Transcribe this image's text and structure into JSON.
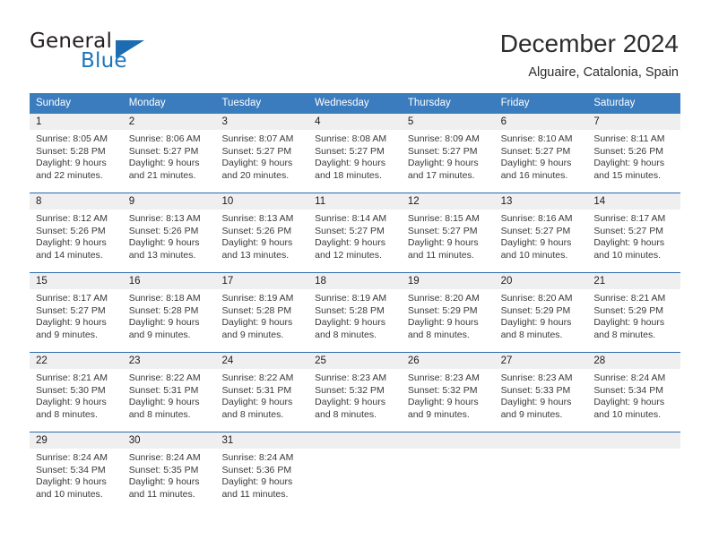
{
  "brand": {
    "name_part1": "General",
    "name_part2": "Blue",
    "flag_icon": "triangle-flag-icon",
    "accent_color": "#1b75bb"
  },
  "header": {
    "title": "December 2024",
    "location": "Alguaire, Catalonia, Spain"
  },
  "theme": {
    "header_row_bg": "#3b7cbe",
    "week_divider": "#2b6cad",
    "daynum_band_bg": "#efefef",
    "text_color": "#39393b"
  },
  "weekdays": [
    "Sunday",
    "Monday",
    "Tuesday",
    "Wednesday",
    "Thursday",
    "Friday",
    "Saturday"
  ],
  "weeks": [
    {
      "days": [
        {
          "num": "1",
          "sunrise": "Sunrise: 8:05 AM",
          "sunset": "Sunset: 5:28 PM",
          "daylight1": "Daylight: 9 hours",
          "daylight2": "and 22 minutes."
        },
        {
          "num": "2",
          "sunrise": "Sunrise: 8:06 AM",
          "sunset": "Sunset: 5:27 PM",
          "daylight1": "Daylight: 9 hours",
          "daylight2": "and 21 minutes."
        },
        {
          "num": "3",
          "sunrise": "Sunrise: 8:07 AM",
          "sunset": "Sunset: 5:27 PM",
          "daylight1": "Daylight: 9 hours",
          "daylight2": "and 20 minutes."
        },
        {
          "num": "4",
          "sunrise": "Sunrise: 8:08 AM",
          "sunset": "Sunset: 5:27 PM",
          "daylight1": "Daylight: 9 hours",
          "daylight2": "and 18 minutes."
        },
        {
          "num": "5",
          "sunrise": "Sunrise: 8:09 AM",
          "sunset": "Sunset: 5:27 PM",
          "daylight1": "Daylight: 9 hours",
          "daylight2": "and 17 minutes."
        },
        {
          "num": "6",
          "sunrise": "Sunrise: 8:10 AM",
          "sunset": "Sunset: 5:27 PM",
          "daylight1": "Daylight: 9 hours",
          "daylight2": "and 16 minutes."
        },
        {
          "num": "7",
          "sunrise": "Sunrise: 8:11 AM",
          "sunset": "Sunset: 5:26 PM",
          "daylight1": "Daylight: 9 hours",
          "daylight2": "and 15 minutes."
        }
      ]
    },
    {
      "days": [
        {
          "num": "8",
          "sunrise": "Sunrise: 8:12 AM",
          "sunset": "Sunset: 5:26 PM",
          "daylight1": "Daylight: 9 hours",
          "daylight2": "and 14 minutes."
        },
        {
          "num": "9",
          "sunrise": "Sunrise: 8:13 AM",
          "sunset": "Sunset: 5:26 PM",
          "daylight1": "Daylight: 9 hours",
          "daylight2": "and 13 minutes."
        },
        {
          "num": "10",
          "sunrise": "Sunrise: 8:13 AM",
          "sunset": "Sunset: 5:26 PM",
          "daylight1": "Daylight: 9 hours",
          "daylight2": "and 13 minutes."
        },
        {
          "num": "11",
          "sunrise": "Sunrise: 8:14 AM",
          "sunset": "Sunset: 5:27 PM",
          "daylight1": "Daylight: 9 hours",
          "daylight2": "and 12 minutes."
        },
        {
          "num": "12",
          "sunrise": "Sunrise: 8:15 AM",
          "sunset": "Sunset: 5:27 PM",
          "daylight1": "Daylight: 9 hours",
          "daylight2": "and 11 minutes."
        },
        {
          "num": "13",
          "sunrise": "Sunrise: 8:16 AM",
          "sunset": "Sunset: 5:27 PM",
          "daylight1": "Daylight: 9 hours",
          "daylight2": "and 10 minutes."
        },
        {
          "num": "14",
          "sunrise": "Sunrise: 8:17 AM",
          "sunset": "Sunset: 5:27 PM",
          "daylight1": "Daylight: 9 hours",
          "daylight2": "and 10 minutes."
        }
      ]
    },
    {
      "days": [
        {
          "num": "15",
          "sunrise": "Sunrise: 8:17 AM",
          "sunset": "Sunset: 5:27 PM",
          "daylight1": "Daylight: 9 hours",
          "daylight2": "and 9 minutes."
        },
        {
          "num": "16",
          "sunrise": "Sunrise: 8:18 AM",
          "sunset": "Sunset: 5:28 PM",
          "daylight1": "Daylight: 9 hours",
          "daylight2": "and 9 minutes."
        },
        {
          "num": "17",
          "sunrise": "Sunrise: 8:19 AM",
          "sunset": "Sunset: 5:28 PM",
          "daylight1": "Daylight: 9 hours",
          "daylight2": "and 9 minutes."
        },
        {
          "num": "18",
          "sunrise": "Sunrise: 8:19 AM",
          "sunset": "Sunset: 5:28 PM",
          "daylight1": "Daylight: 9 hours",
          "daylight2": "and 8 minutes."
        },
        {
          "num": "19",
          "sunrise": "Sunrise: 8:20 AM",
          "sunset": "Sunset: 5:29 PM",
          "daylight1": "Daylight: 9 hours",
          "daylight2": "and 8 minutes."
        },
        {
          "num": "20",
          "sunrise": "Sunrise: 8:20 AM",
          "sunset": "Sunset: 5:29 PM",
          "daylight1": "Daylight: 9 hours",
          "daylight2": "and 8 minutes."
        },
        {
          "num": "21",
          "sunrise": "Sunrise: 8:21 AM",
          "sunset": "Sunset: 5:29 PM",
          "daylight1": "Daylight: 9 hours",
          "daylight2": "and 8 minutes."
        }
      ]
    },
    {
      "days": [
        {
          "num": "22",
          "sunrise": "Sunrise: 8:21 AM",
          "sunset": "Sunset: 5:30 PM",
          "daylight1": "Daylight: 9 hours",
          "daylight2": "and 8 minutes."
        },
        {
          "num": "23",
          "sunrise": "Sunrise: 8:22 AM",
          "sunset": "Sunset: 5:31 PM",
          "daylight1": "Daylight: 9 hours",
          "daylight2": "and 8 minutes."
        },
        {
          "num": "24",
          "sunrise": "Sunrise: 8:22 AM",
          "sunset": "Sunset: 5:31 PM",
          "daylight1": "Daylight: 9 hours",
          "daylight2": "and 8 minutes."
        },
        {
          "num": "25",
          "sunrise": "Sunrise: 8:23 AM",
          "sunset": "Sunset: 5:32 PM",
          "daylight1": "Daylight: 9 hours",
          "daylight2": "and 8 minutes."
        },
        {
          "num": "26",
          "sunrise": "Sunrise: 8:23 AM",
          "sunset": "Sunset: 5:32 PM",
          "daylight1": "Daylight: 9 hours",
          "daylight2": "and 9 minutes."
        },
        {
          "num": "27",
          "sunrise": "Sunrise: 8:23 AM",
          "sunset": "Sunset: 5:33 PM",
          "daylight1": "Daylight: 9 hours",
          "daylight2": "and 9 minutes."
        },
        {
          "num": "28",
          "sunrise": "Sunrise: 8:24 AM",
          "sunset": "Sunset: 5:34 PM",
          "daylight1": "Daylight: 9 hours",
          "daylight2": "and 10 minutes."
        }
      ]
    },
    {
      "days": [
        {
          "num": "29",
          "sunrise": "Sunrise: 8:24 AM",
          "sunset": "Sunset: 5:34 PM",
          "daylight1": "Daylight: 9 hours",
          "daylight2": "and 10 minutes."
        },
        {
          "num": "30",
          "sunrise": "Sunrise: 8:24 AM",
          "sunset": "Sunset: 5:35 PM",
          "daylight1": "Daylight: 9 hours",
          "daylight2": "and 11 minutes."
        },
        {
          "num": "31",
          "sunrise": "Sunrise: 8:24 AM",
          "sunset": "Sunset: 5:36 PM",
          "daylight1": "Daylight: 9 hours",
          "daylight2": "and 11 minutes."
        },
        {
          "num": "",
          "sunrise": "",
          "sunset": "",
          "daylight1": "",
          "daylight2": ""
        },
        {
          "num": "",
          "sunrise": "",
          "sunset": "",
          "daylight1": "",
          "daylight2": ""
        },
        {
          "num": "",
          "sunrise": "",
          "sunset": "",
          "daylight1": "",
          "daylight2": ""
        },
        {
          "num": "",
          "sunrise": "",
          "sunset": "",
          "daylight1": "",
          "daylight2": ""
        }
      ]
    }
  ]
}
